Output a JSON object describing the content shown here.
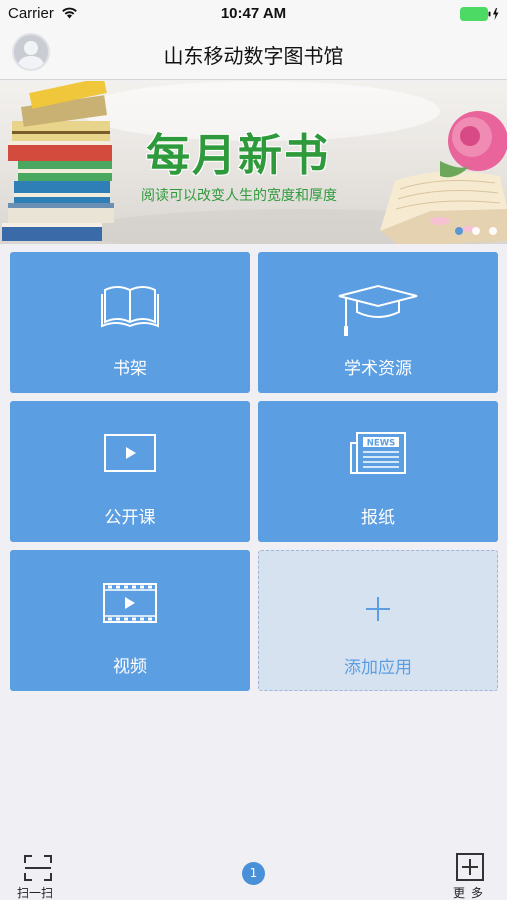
{
  "status_bar": {
    "carrier": "Carrier",
    "time": "10:47 AM",
    "battery_color": "#4cd964"
  },
  "nav": {
    "title": "山东移动数字图书馆",
    "avatar_icon": "user-avatar-icon"
  },
  "banner": {
    "title": "每月新书",
    "subtitle": "阅读可以改变人生的宽度和厚度",
    "title_color": "#2f9a3c",
    "slide_count": 3,
    "active_slide": 1
  },
  "tiles": [
    {
      "label": "书架",
      "icon": "book-open-icon"
    },
    {
      "label": "学术资源",
      "icon": "graduation-cap-icon"
    },
    {
      "label": "公开课",
      "icon": "play-screen-icon"
    },
    {
      "label": "报纸",
      "icon": "newspaper-icon",
      "icon_text": "NEWS"
    },
    {
      "label": "视频",
      "icon": "film-icon"
    },
    {
      "label": "添加应用",
      "icon": "plus-icon"
    }
  ],
  "bottom_bar": {
    "scan_label": "扫一扫",
    "page_number": "1",
    "more_label": "更多"
  },
  "colors": {
    "tile_blue": "#5b9ee2",
    "add_tile_bg": "#d7e2f1",
    "page_bg": "#efeff4"
  }
}
